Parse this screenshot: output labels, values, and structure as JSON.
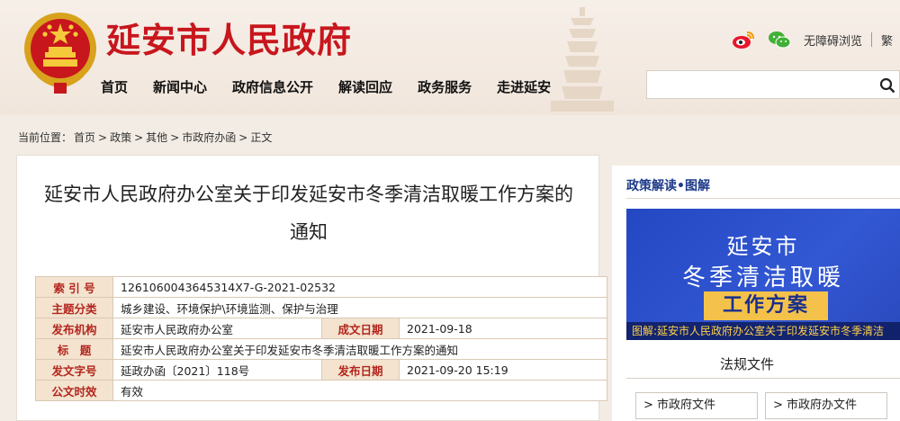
{
  "header": {
    "site_title": "延安市人民政府",
    "nav": [
      "首页",
      "新闻中心",
      "政府信息公开",
      "解读回应",
      "政务服务",
      "走进延安"
    ],
    "tools": {
      "accessibility": "无障碍浏览",
      "traditional": "繁"
    }
  },
  "breadcrumb": {
    "label": "当前位置：",
    "items": [
      "首页",
      "政策",
      "其他",
      "市政府办函",
      "正文"
    ],
    "separator": ">"
  },
  "article": {
    "title": "延安市人民政府办公室关于印发延安市冬季清洁取暖工作方案的通知",
    "meta": {
      "index_label": "索 引 号",
      "index_value": "1261060043645314X7-G-2021-02532",
      "topic_label": "主题分类",
      "topic_value": "城乡建设、环境保护\\环境监测、保护与治理",
      "publisher_label": "发布机构",
      "publisher_value": "延安市人民政府办公室",
      "created_label": "成文日期",
      "created_value": "2021-09-18",
      "title_label": "标　题",
      "title_value": "延安市人民政府办公室关于印发延安市冬季清洁取暖工作方案的通知",
      "docno_label": "发文字号",
      "docno_value": "延政办函〔2021〕118号",
      "pubdate_label": "发布日期",
      "pubdate_value": "2021-09-20 15:19",
      "validity_label": "公文时效",
      "validity_value": "有效"
    }
  },
  "sidebar": {
    "heading": "政策解读•图解",
    "banner": {
      "line1": "延安市",
      "line2": "冬季清洁取暖",
      "line3": "工作方案",
      "caption": "图解:延安市人民政府办公室关于印发延安市冬季清洁"
    },
    "tab": "法规文件",
    "buttons": [
      "> 市政府文件",
      "> 市政府办文件"
    ]
  },
  "colors": {
    "title_red": "#c8161d",
    "banner_blue": "#2447c2",
    "label_red": "#b3261e"
  }
}
